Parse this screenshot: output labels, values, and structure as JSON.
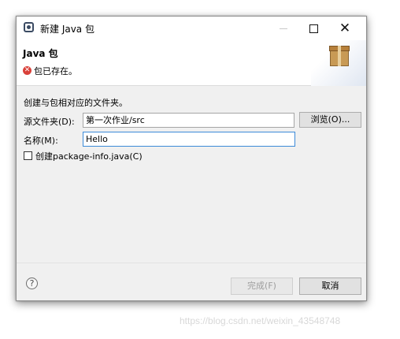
{
  "window": {
    "title": "新建 Java 包",
    "minimize_icon": "minimize-icon",
    "maximize_icon": "maximize-icon",
    "close_icon": "close-icon",
    "close_glyph": "✕"
  },
  "header": {
    "title": "Java 包",
    "message": "包已存在。",
    "error_icon": "error-icon",
    "error_glyph": "✕",
    "banner_icon": "package-icon"
  },
  "form": {
    "section_label": "创建与包相对应的文件夹。",
    "source_folder_label": "源文件夹(D):",
    "source_folder_value": "第一次作业/src",
    "browse_label": "浏览(O)...",
    "name_label": "名称(M):",
    "name_value": "Hello",
    "package_info_label": "创建package-info.java(C)",
    "package_info_checked": false
  },
  "footer": {
    "help_glyph": "?",
    "finish_label": "完成(F)",
    "finish_enabled": false,
    "cancel_label": "取消"
  },
  "watermark": "https://blog.csdn.net/weixin_43548748",
  "colors": {
    "dialog_bg": "#f0f0f0",
    "error": "#d9413a",
    "focus_border": "#3c8ad8",
    "disabled_text": "#9d9d9d"
  }
}
